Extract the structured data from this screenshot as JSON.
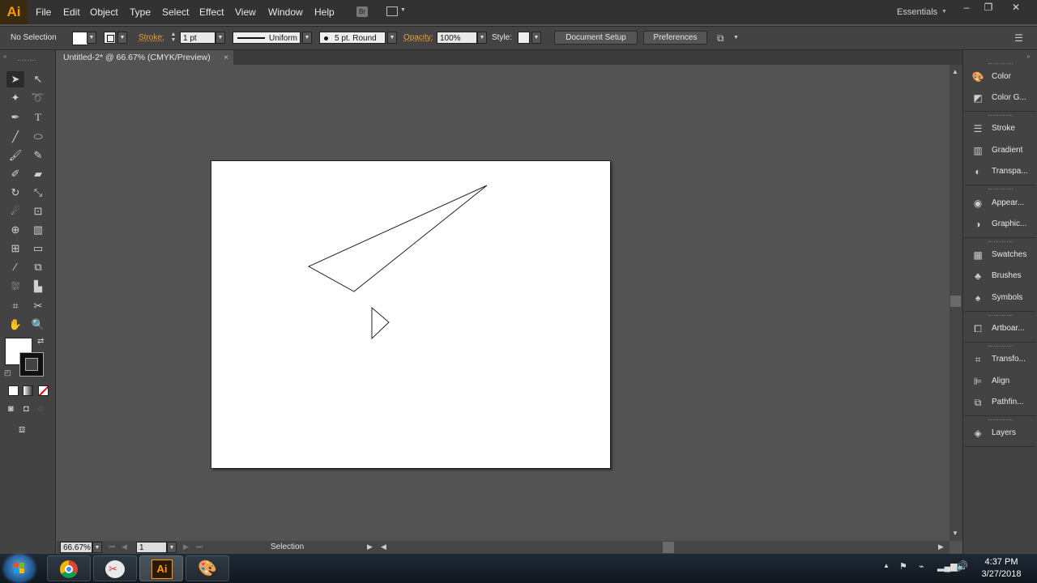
{
  "app": {
    "logo": "Ai",
    "workspace": "Essentials"
  },
  "menu": [
    "File",
    "Edit",
    "Object",
    "Type",
    "Select",
    "Effect",
    "View",
    "Window",
    "Help"
  ],
  "menubar_icons": [
    "bridge-icon",
    "arrange-documents-icon"
  ],
  "window_controls": {
    "minimize": "–",
    "restore": "❐",
    "close": "✕"
  },
  "control_bar": {
    "selection_status": "No Selection",
    "stroke_label": "Stroke:",
    "stroke_weight": "1 pt",
    "profile": "Uniform",
    "brush": "5 pt. Round",
    "opacity_label": "Opacity:",
    "opacity": "100%",
    "style_label": "Style:",
    "document_setup": "Document Setup",
    "preferences": "Preferences"
  },
  "document_tab": {
    "title": "Untitled-2* @ 66.67% (CMYK/Preview)",
    "close": "×"
  },
  "tools": [
    "selection-tool",
    "direct-selection-tool",
    "magic-wand-tool",
    "lasso-tool",
    "pen-tool",
    "type-tool",
    "line-segment-tool",
    "ellipse-tool",
    "paintbrush-tool",
    "pencil-tool",
    "blob-brush-tool",
    "eraser-tool",
    "rotate-tool",
    "scale-tool",
    "warp-tool",
    "free-transform-tool",
    "shape-builder-tool",
    "perspective-grid-tool",
    "mesh-tool",
    "gradient-tool",
    "eyedropper-tool",
    "blend-tool",
    "symbol-sprayer-tool",
    "column-graph-tool",
    "artboard-tool",
    "slice-tool",
    "hand-tool",
    "zoom-tool"
  ],
  "dock": [
    {
      "label": "Color",
      "icon": "color-palette-icon"
    },
    {
      "label": "Color G...",
      "icon": "color-guide-icon"
    },
    {
      "label": "Stroke",
      "icon": "stroke-lines-icon"
    },
    {
      "label": "Gradient",
      "icon": "gradient-icon"
    },
    {
      "label": "Transpa...",
      "icon": "transparency-icon"
    },
    {
      "label": "Appear...",
      "icon": "appearance-icon"
    },
    {
      "label": "Graphic...",
      "icon": "graphic-styles-icon"
    },
    {
      "label": "Swatches",
      "icon": "swatches-grid-icon"
    },
    {
      "label": "Brushes",
      "icon": "brushes-icon"
    },
    {
      "label": "Symbols",
      "icon": "symbols-icon"
    },
    {
      "label": "Artboar...",
      "icon": "artboards-icon"
    },
    {
      "label": "Transfo...",
      "icon": "transform-icon"
    },
    {
      "label": "Align",
      "icon": "align-icon"
    },
    {
      "label": "Pathfin...",
      "icon": "pathfinder-icon"
    },
    {
      "label": "Layers",
      "icon": "layers-icon"
    }
  ],
  "status_bar": {
    "zoom": "66.67%",
    "artboard": "1",
    "tool_status": "Selection"
  },
  "taskbar": {
    "apps": [
      "chrome-icon",
      "snipping-tool-icon",
      "illustrator-icon",
      "paint-icon"
    ],
    "time": "4:37 PM",
    "date": "3/27/2018"
  },
  "colors": {
    "accent": "#ff9a00",
    "canvas_bg": "#535353",
    "panel_bg": "#434343",
    "artboard": "#ffffff"
  }
}
